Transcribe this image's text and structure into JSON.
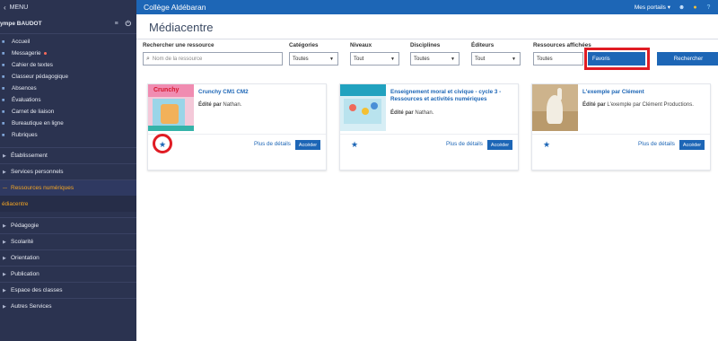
{
  "topbar": {
    "menu_label": "MENU",
    "school": "Collège Aldébaran",
    "portals": "Mes portails"
  },
  "sidebar": {
    "user": "ympe BAUDOT",
    "items": [
      {
        "label": "Accueil",
        "dot": false
      },
      {
        "label": "Messagerie",
        "dot": true
      },
      {
        "label": "Cahier de textes",
        "dot": false
      },
      {
        "label": "Classeur pédagogique",
        "dot": false
      },
      {
        "label": "Absences",
        "dot": false
      },
      {
        "label": "Évaluations",
        "dot": false
      },
      {
        "label": "Carnet de liaison",
        "dot": false
      },
      {
        "label": "Bureautique en ligne",
        "dot": false
      },
      {
        "label": "Rubriques",
        "dot": false
      }
    ],
    "sections_top": [
      "Établissement",
      "Services personnels"
    ],
    "active_section": "Ressources numériques",
    "active_sub": "édiacentre",
    "sections_bottom": [
      "Pédagogie",
      "Scolarité",
      "Orientation",
      "Publication",
      "Espace des classes",
      "Autres Services"
    ]
  },
  "main": {
    "title": "Médiacentre",
    "filters": {
      "search_label": "Rechercher une ressource",
      "search_placeholder": "Nom de la ressource",
      "categories_label": "Catégories",
      "categories_value": "Toutes",
      "niveaux_label": "Niveaux",
      "niveaux_value": "Tout",
      "disciplines_label": "Disciplines",
      "disciplines_value": "Toutes",
      "editeurs_label": "Éditeurs",
      "editeurs_value": "Tout",
      "ressources_label": "Ressources affichées",
      "ressources_value": "Toutes",
      "favoris_label": "Favoris",
      "search_button": "Rechercher"
    },
    "cards": [
      {
        "title": "Crunchy CM1 CM2",
        "pub_prefix": "Édité par",
        "publisher": "Nathan.",
        "more": "Plus de détails",
        "access": "Accéder",
        "thumb_logo": "Crunchy"
      },
      {
        "title": "Enseignement moral et civique - cycle 3 - Ressources et activités numériques",
        "pub_prefix": "Édité par",
        "publisher": "Nathan.",
        "more": "Plus de détails",
        "access": "Accéder"
      },
      {
        "title": "L'exemple par Clément",
        "pub_prefix": "Édité par",
        "publisher": "L'exemple par Clément Productions.",
        "more": "Plus de détails",
        "access": "Accéder"
      }
    ]
  },
  "colors": {
    "sidebar_bg": "#2b3350",
    "topbar_blue": "#1d66b6",
    "active_orange": "#f5a623",
    "highlight_red": "#e01c24"
  },
  "icons": {
    "chevron": "chevron-left-icon",
    "star": "star-icon",
    "search": "search-icon"
  }
}
